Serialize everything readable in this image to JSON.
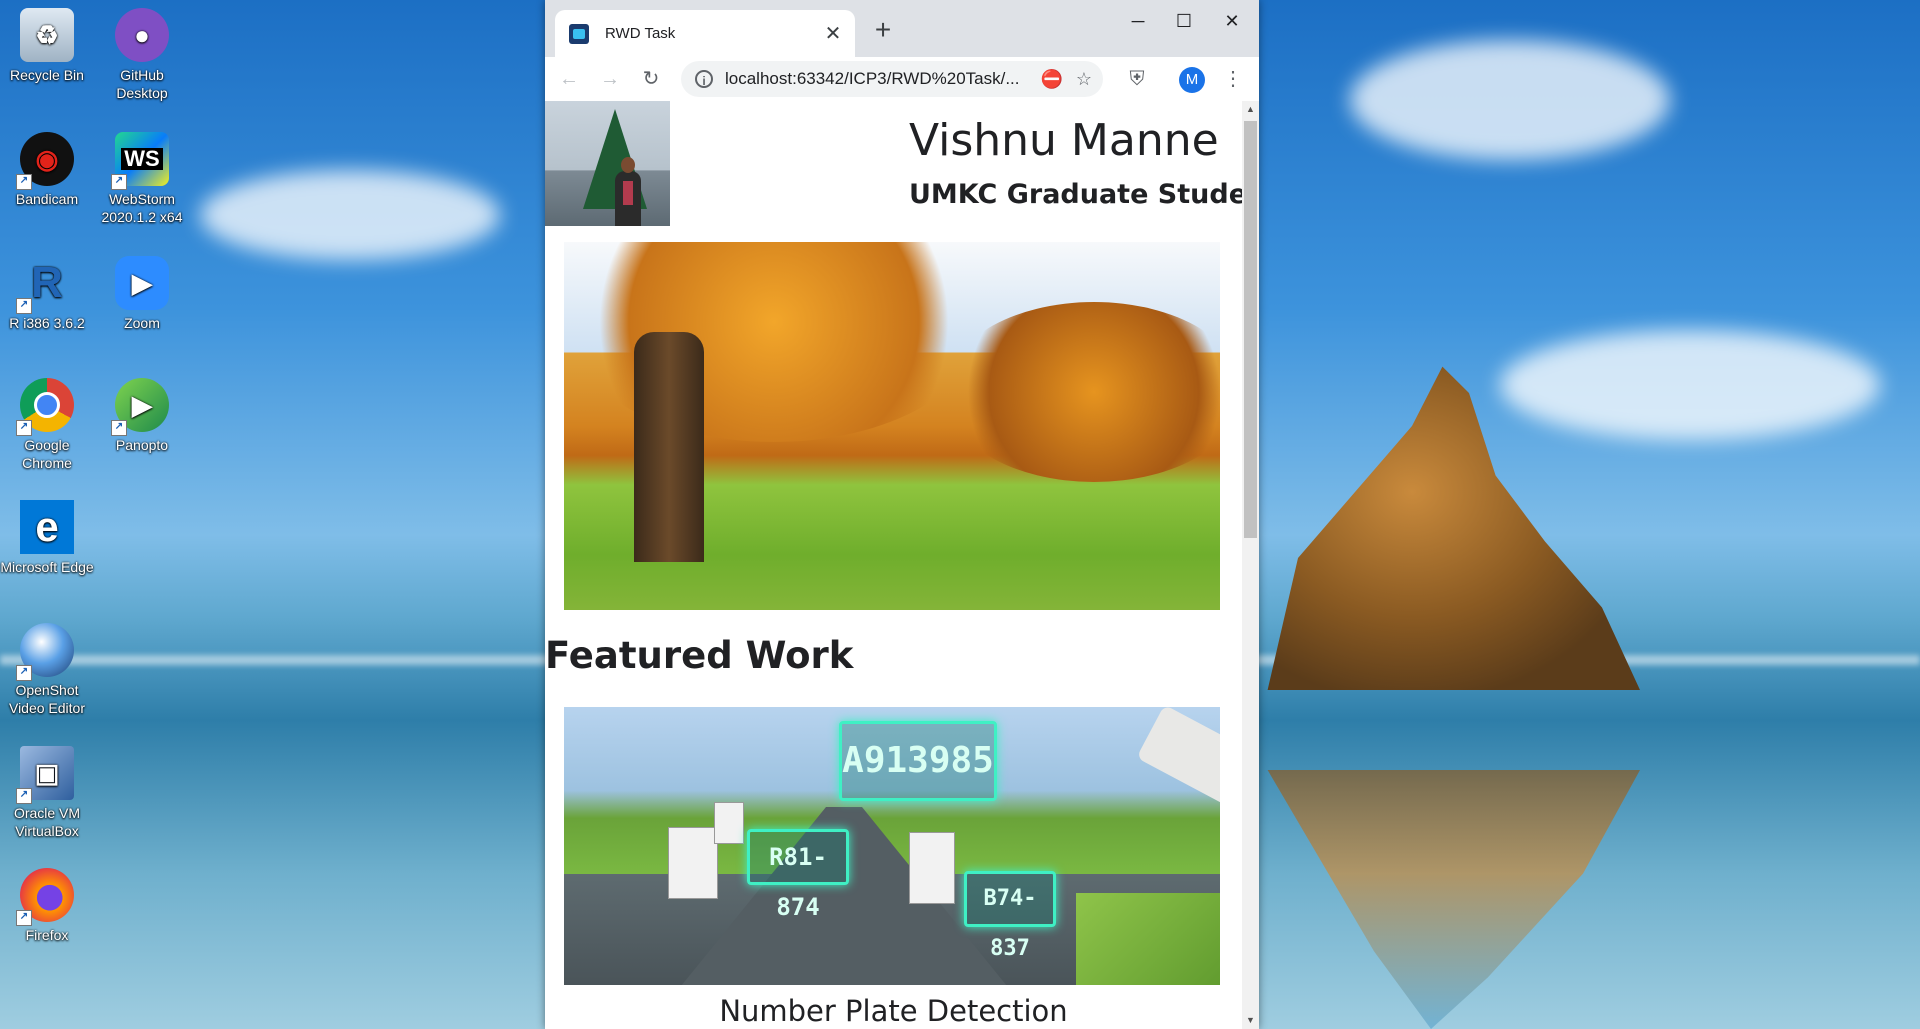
{
  "desktop": {
    "icons": [
      {
        "label": "Recycle Bin",
        "icon": "recycle-bin-icon"
      },
      {
        "label": "GitHub Desktop",
        "icon": "github-desktop-icon"
      },
      {
        "label": "Bandicam",
        "icon": "bandicam-icon"
      },
      {
        "label": "WebStorm 2020.1.2 x64",
        "icon": "webstorm-icon"
      },
      {
        "label": "R i386 3.6.2",
        "icon": "r-icon"
      },
      {
        "label": "Zoom",
        "icon": "zoom-icon"
      },
      {
        "label": "Google Chrome",
        "icon": "chrome-icon"
      },
      {
        "label": "Panopto",
        "icon": "panopto-icon"
      },
      {
        "label": "Microsoft Edge",
        "icon": "edge-icon"
      },
      {
        "label": "OpenShot Video Editor",
        "icon": "openshot-icon"
      },
      {
        "label": "Oracle VM VirtualBox",
        "icon": "virtualbox-icon"
      },
      {
        "label": "Firefox",
        "icon": "firefox-icon"
      }
    ]
  },
  "browser": {
    "tab_title": "RWD Task",
    "url": "localhost:63342/ICP3/RWD%20Task/...",
    "profile_initial": "M"
  },
  "page": {
    "name": "Vishnu Manne",
    "subtitle": "UMKC Graduate Student",
    "section_title": "Featured Work",
    "work_caption": "Number Plate Detection",
    "plates": [
      "A913985",
      "R81-874",
      "B74-837"
    ]
  },
  "colors": {
    "accent": "#1a73e8",
    "plate_glow": "#3ff0c4"
  }
}
